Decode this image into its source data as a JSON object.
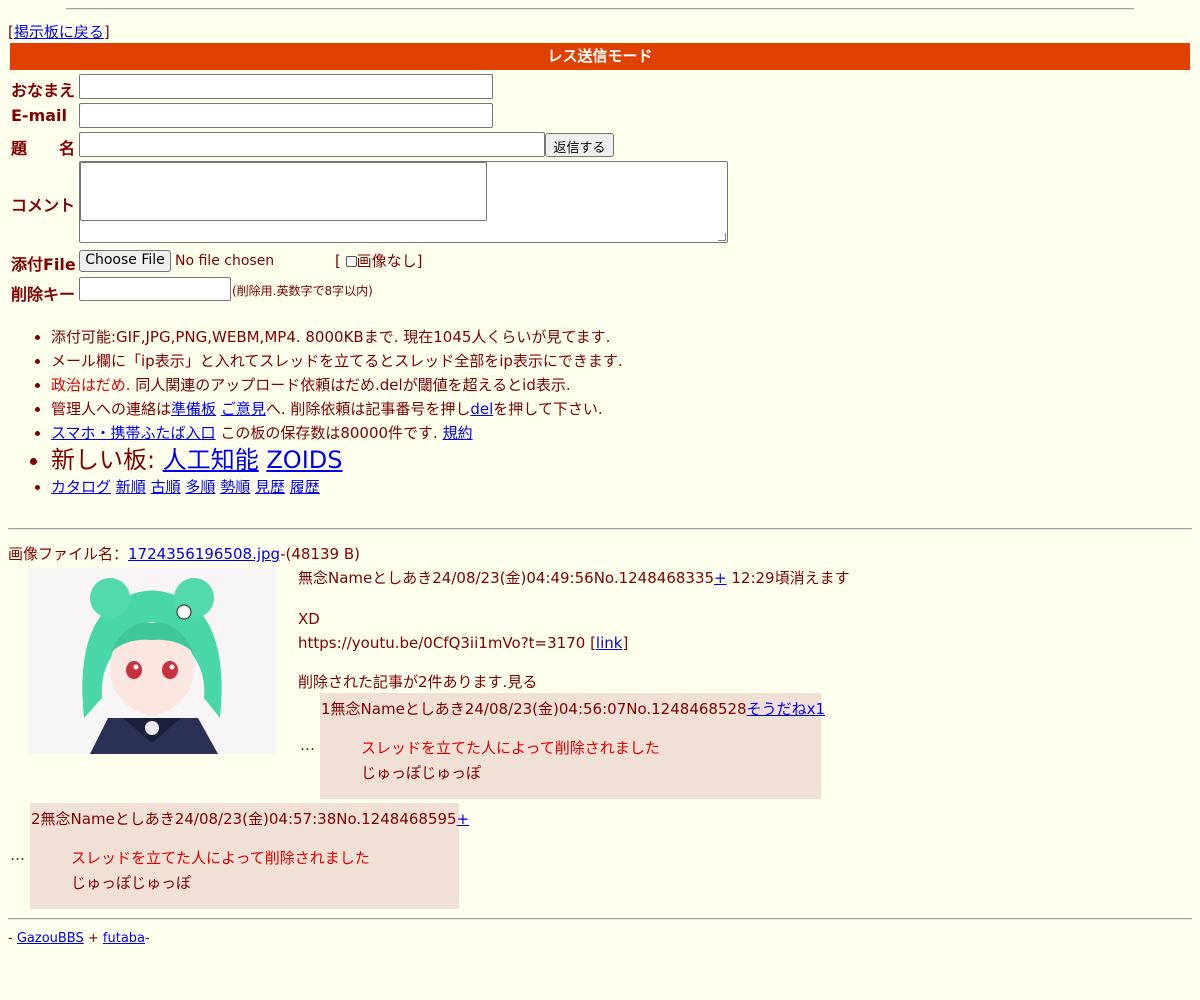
{
  "nav": {
    "back_open": "[",
    "back_link": "掲示板に戻る",
    "back_close": "]"
  },
  "form": {
    "mode_title": "レス送信モード",
    "name_label": "おなまえ",
    "email_label": "E-mail",
    "subject_label": "題　　名",
    "submit_label": "返信する",
    "comment_label": "コメント",
    "file_label": "添付File",
    "choose_file_label": "Choose File",
    "no_file_text": "No file chosen",
    "no_image_open": "[",
    "no_image_label": "画像なし",
    "no_image_close": "]",
    "delkey_label": "削除キー",
    "delkey_hint": "(削除用.英数字で8字以内)"
  },
  "rules": {
    "r1": "添付可能:GIF,JPG,PNG,WEBM,MP4. 8000KBまで. 現在1045人くらいが見てます.",
    "r2": "メール欄に「ip表示」と入れてスレッドを立てるとスレッド全部をip表示にできます.",
    "r3_red": "政治はだめ.",
    "r3_rest": " 同人関連のアップロード依頼はだめ.delが閾値を超えるとid表示.",
    "r4_a": "管理人への連絡は",
    "r4_link1": "準備板",
    "r4_sp": " ",
    "r4_link2": "ご意見",
    "r4_b": "へ. 削除依頼は記事番号を押し",
    "r4_link3": "del",
    "r4_c": "を押して下さい.",
    "r5_link": "スマホ・携帯ふたば入口",
    "r5_text": " この板の保存数は80000件です. ",
    "r5_link2": "規約",
    "r6_text": "新しい板: ",
    "r6_link1": "人工知能",
    "r6_link2": "ZOIDS",
    "r7_links": [
      "カタログ",
      "新順",
      "古順",
      "多順",
      "勢順",
      "見歴",
      "履歴"
    ]
  },
  "thread": {
    "file_prefix": "画像ファイル名：",
    "file_name": "1724356196508.jpg",
    "file_size": "-(48139 B)",
    "header": "無念Nameとしあき24/08/23(金)04:49:56No.1248468335",
    "plus": "+",
    "expire": " 12:29頃消えます",
    "body_line1": "XD",
    "body_line2": "https://youtu.be/0CfQ3ii1mVo?t=3170 ",
    "link_open": "[",
    "link_text": "link",
    "link_close": "]",
    "deleted_notice": "削除された記事が2件あります.見る"
  },
  "replies": [
    {
      "ellipsis": "…",
      "header": "1無念Nameとしあき24/08/23(金)04:56:07No.1248468528",
      "action": "そうだねx1",
      "quote": "スレッドを立てた人によって削除されました",
      "text": "じゅっぽじゅっぽ"
    },
    {
      "ellipsis": "…",
      "header": "2無念Nameとしあき24/08/23(金)04:57:38No.1248468595",
      "action": "+",
      "quote": "スレッドを立てた人によって削除されました",
      "text": "じゅっぽじゅっぽ"
    }
  ],
  "footer": {
    "prefix": "- ",
    "link1": "GazouBBS",
    "sep": " + ",
    "link2": "futaba",
    "suffix": "-"
  },
  "colors": {
    "background": "#ffffee",
    "text": "#800000",
    "header_bar": "#e04000",
    "reply_bg": "#f0e0d6",
    "link": "#0000ee",
    "quote": "#e00000"
  }
}
